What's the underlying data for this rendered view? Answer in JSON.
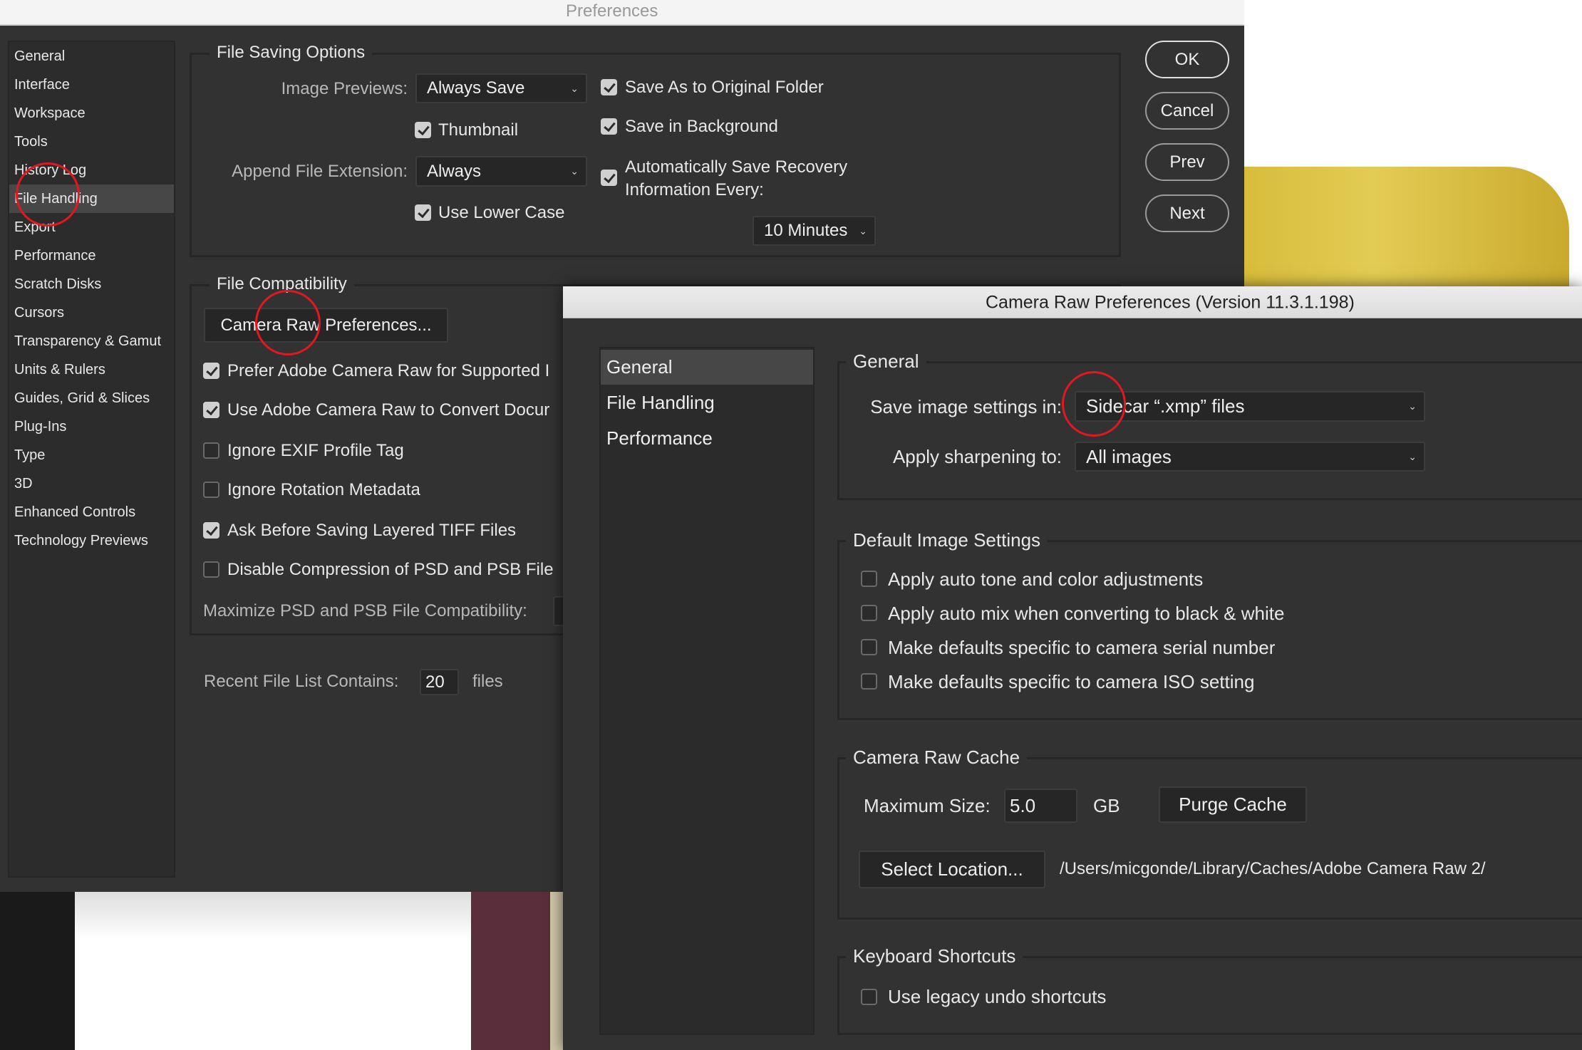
{
  "preferences": {
    "title": "Preferences",
    "sidebar": [
      "General",
      "Interface",
      "Workspace",
      "Tools",
      "History Log",
      "File Handling",
      "Export",
      "Performance",
      "Scratch Disks",
      "Cursors",
      "Transparency & Gamut",
      "Units & Rulers",
      "Guides, Grid & Slices",
      "Plug-Ins",
      "Type",
      "3D",
      "Enhanced Controls",
      "Technology Previews"
    ],
    "selected_sidebar": "File Handling",
    "file_saving": {
      "legend": "File Saving Options",
      "image_previews_label": "Image Previews:",
      "image_previews_value": "Always Save",
      "thumbnail": {
        "label": "Thumbnail",
        "checked": true
      },
      "append_ext_label": "Append File Extension:",
      "append_ext_value": "Always",
      "lower_case": {
        "label": "Use Lower Case",
        "checked": true
      },
      "save_as_original": {
        "label": "Save As to Original Folder",
        "checked": true
      },
      "save_background": {
        "label": "Save in Background",
        "checked": true
      },
      "auto_save": {
        "label_line1": "Automatically Save Recovery",
        "label_line2": "Information Every:",
        "checked": true
      },
      "auto_save_interval": "10 Minutes"
    },
    "file_compat": {
      "legend": "File Compatibility",
      "camera_raw_button": "Camera Raw Preferences...",
      "options": [
        {
          "label": "Prefer Adobe Camera Raw for Supported I",
          "checked": true
        },
        {
          "label": "Use Adobe Camera Raw to Convert Docur",
          "checked": true
        },
        {
          "label": "Ignore EXIF Profile Tag",
          "checked": false
        },
        {
          "label": "Ignore Rotation Metadata",
          "checked": false
        },
        {
          "label": "Ask Before Saving Layered TIFF Files",
          "checked": true
        },
        {
          "label": "Disable Compression of PSD and PSB File",
          "checked": false
        }
      ],
      "maximize_label": "Maximize PSD and PSB File Compatibility:"
    },
    "recent": {
      "label": "Recent File List Contains:",
      "value": "20",
      "unit": "files"
    },
    "buttons": {
      "ok": "OK",
      "cancel": "Cancel",
      "prev": "Prev",
      "next": "Next"
    }
  },
  "camera_raw": {
    "title": "Camera Raw Preferences  (Version 11.3.1.198)",
    "sidebar": [
      "General",
      "File Handling",
      "Performance"
    ],
    "selected_sidebar": "General",
    "general": {
      "legend": "General",
      "save_settings_label": "Save image settings in:",
      "save_settings_value": "Sidecar “.xmp” files",
      "sharpening_label": "Apply sharpening to:",
      "sharpening_value": "All images"
    },
    "defaults": {
      "legend": "Default Image Settings",
      "options": [
        {
          "label": "Apply auto tone and color adjustments",
          "checked": false
        },
        {
          "label": "Apply auto mix when converting to black & white",
          "checked": false
        },
        {
          "label": "Make defaults specific to camera serial number",
          "checked": false
        },
        {
          "label": "Make defaults specific to camera ISO setting",
          "checked": false
        }
      ]
    },
    "cache": {
      "legend": "Camera Raw Cache",
      "max_size_label": "Maximum Size:",
      "max_size_value": "5.0",
      "unit": "GB",
      "purge_button": "Purge Cache",
      "select_location_button": "Select Location...",
      "path": "/Users/micgonde/Library/Caches/Adobe Camera Raw 2/"
    },
    "keyboard": {
      "legend": "Keyboard Shortcuts",
      "legacy_undo": {
        "label": "Use legacy undo shortcuts",
        "checked": false
      }
    }
  },
  "colors": {
    "annotation_ring": "#e0191e",
    "panel_bg": "#323232",
    "selected_row": "#474747"
  }
}
